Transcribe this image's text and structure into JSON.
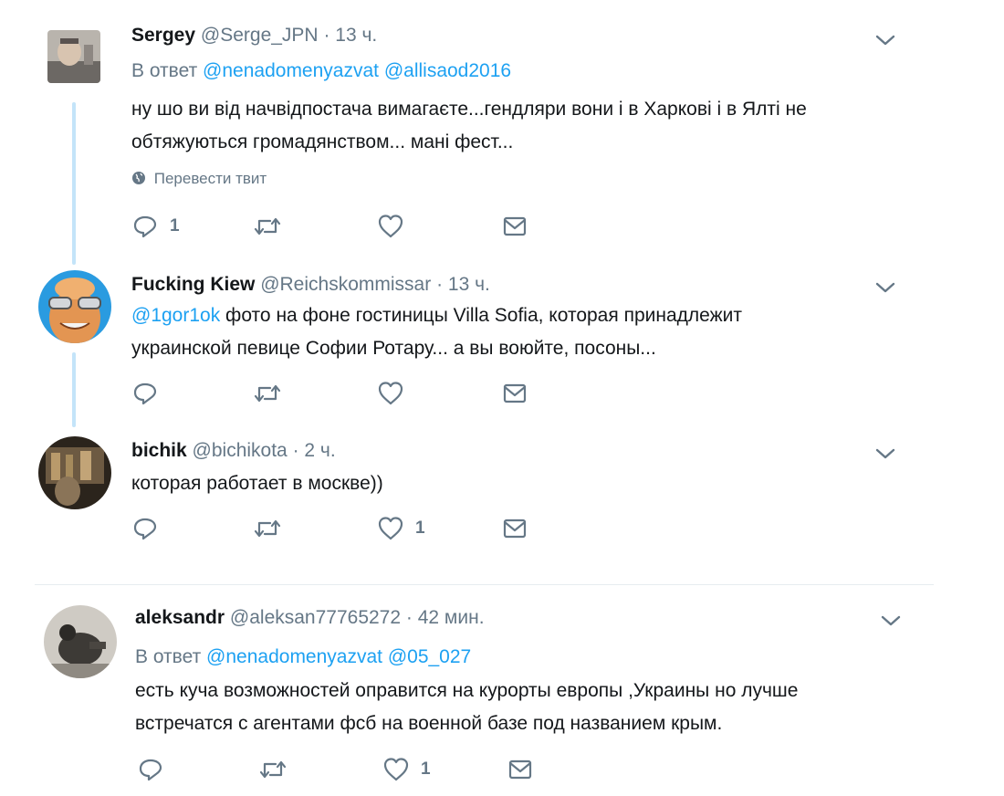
{
  "tweets": [
    {
      "name": "Sergey",
      "handle": "@Serge_JPN",
      "dot": "·",
      "time": "13 ч.",
      "reply_prefix": "В ответ",
      "reply_mentions": [
        "@nenadomenyazvat",
        "@allisaod2016"
      ],
      "text_lines": [
        "ну шо ви від начвідпостача вимагаєте...гендляри вони і в Харкові і в Ялті не",
        "обтяжуються громадянством... мані фест..."
      ],
      "translate_label": "Перевести твит",
      "reply_count": "1",
      "retweet_count": "",
      "like_count": ""
    },
    {
      "name": "Fucking Kiew",
      "handle": "@Reichskommissar",
      "dot": "·",
      "time": "13 ч.",
      "text_mention": "@1gor1ok",
      "text_lines": [
        " фото на фоне гостиницы Villa Sofia, которая принадлежит",
        "украинской певице Софии Ротару... а вы воюйте, посоны..."
      ],
      "reply_count": "",
      "retweet_count": "",
      "like_count": ""
    },
    {
      "name": "bichik",
      "handle": "@bichikota",
      "dot": "·",
      "time": "2 ч.",
      "text_lines": [
        "которая работает в москве))"
      ],
      "reply_count": "",
      "retweet_count": "",
      "like_count": "1"
    },
    {
      "name": "aleksandr",
      "handle": "@aleksan77765272",
      "dot": "·",
      "time": "42 мин.",
      "reply_prefix": "В ответ",
      "reply_mentions": [
        "@nenadomenyazvat",
        "@05_027"
      ],
      "text_lines": [
        "есть куча возможностей оправится на курорты европы ,Украины но лучше",
        "встречатся с агентами фсб на военной базе под названием крым."
      ],
      "reply_count": "",
      "retweet_count": "",
      "like_count": "1"
    }
  ],
  "colors": {
    "link": "#1da1f2",
    "muted": "#657786",
    "thread": "#c4e4f9"
  },
  "icons": [
    "reply-icon",
    "retweet-icon",
    "like-icon",
    "direct-message-icon",
    "chevron-down-icon",
    "globe-icon"
  ]
}
